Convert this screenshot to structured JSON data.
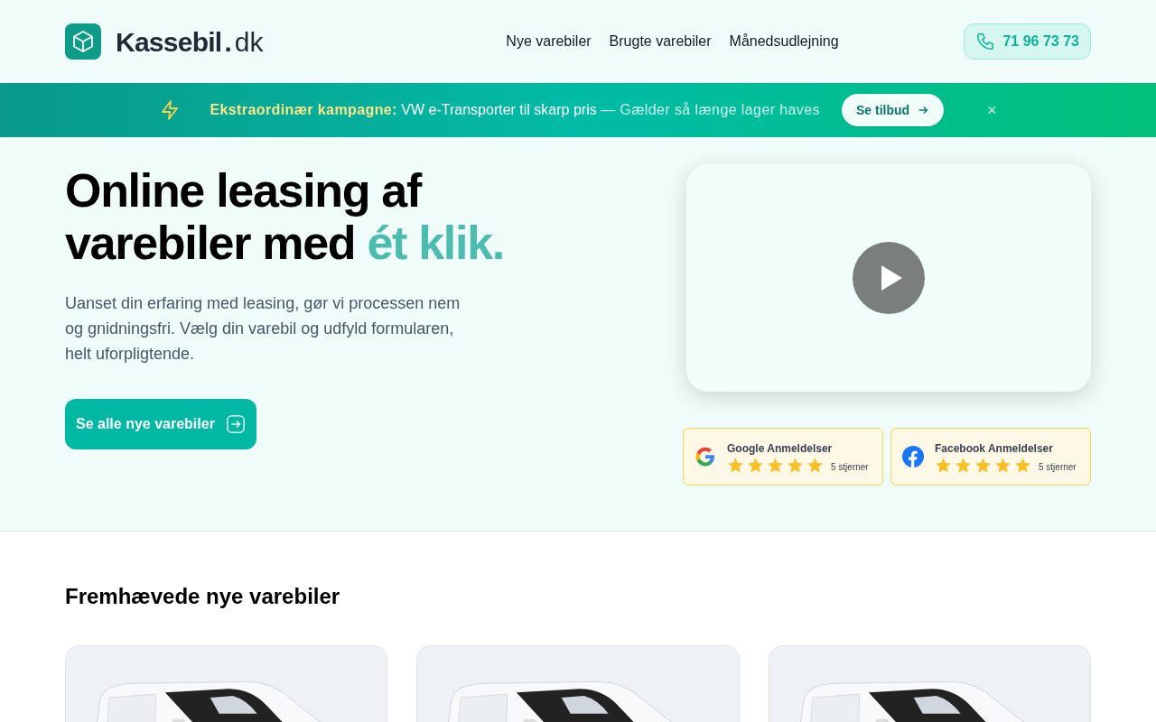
{
  "header": {
    "logo": {
      "name": "Kassebil",
      "separator": ".",
      "suffix": "dk"
    },
    "nav": [
      {
        "label": "Nye varebiler"
      },
      {
        "label": "Brugte varebiler"
      },
      {
        "label": "Månedsudlejning"
      }
    ],
    "phone": "71 96 73 73"
  },
  "banner": {
    "label": "Ekstraordinær kampagne:",
    "headline": "VW e-Transporter til skarp pris",
    "note": "— Gælder så længe lager haves",
    "button": "Se tilbud",
    "close": "×"
  },
  "hero": {
    "headline": "Online leasing af varebiler med",
    "headline_accent": "ét klik.",
    "text": "Uanset din erfaring med leasing, gør vi processen nem og gnidningsfri. Vælg din varebil og udfyld formularen, helt uforpligtende.",
    "button": "Se alle nye varebiler"
  },
  "reviews": [
    {
      "kind": "google",
      "title": "Google Anmeldelser",
      "stars": 5,
      "caption": "5 stjerner"
    },
    {
      "kind": "facebook",
      "title": "Facebook Anmeldelser",
      "stars": 5,
      "caption": "5 stjerner"
    }
  ],
  "featured": {
    "title": "Fremhævede nye varebiler"
  }
}
